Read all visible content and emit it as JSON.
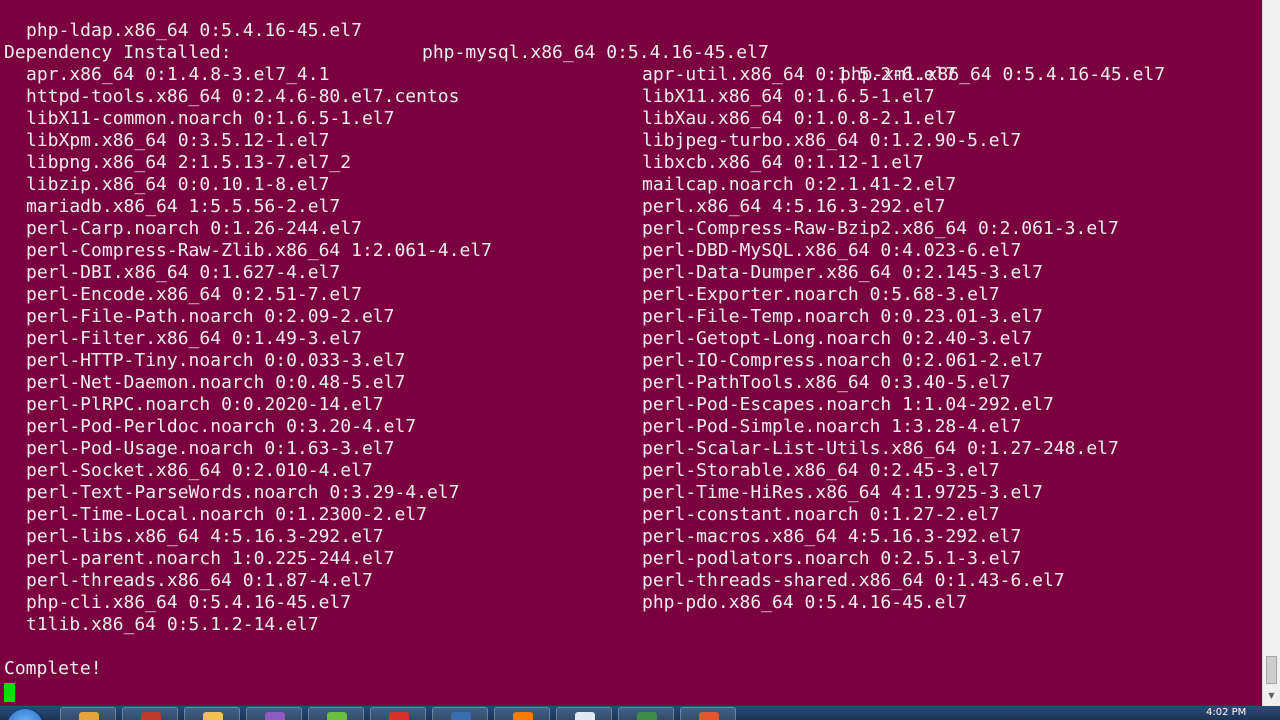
{
  "terminal": {
    "top_packages": [
      "php-ldap.x86_64 0:5.4.16-45.el7",
      "php-mysql.x86_64 0:5.4.16-45.el7",
      "php-xml.x86_64 0:5.4.16-45.el7"
    ],
    "dependency_header": "Dependency Installed:",
    "dependencies": [
      [
        "apr.x86_64 0:1.4.8-3.el7_4.1",
        "apr-util.x86_64 0:1.5.2-6.el7"
      ],
      [
        "httpd-tools.x86_64 0:2.4.6-80.el7.centos",
        "libX11.x86_64 0:1.6.5-1.el7"
      ],
      [
        "libX11-common.noarch 0:1.6.5-1.el7",
        "libXau.x86_64 0:1.0.8-2.1.el7"
      ],
      [
        "libXpm.x86_64 0:3.5.12-1.el7",
        "libjpeg-turbo.x86_64 0:1.2.90-5.el7"
      ],
      [
        "libpng.x86_64 2:1.5.13-7.el7_2",
        "libxcb.x86_64 0:1.12-1.el7"
      ],
      [
        "libzip.x86_64 0:0.10.1-8.el7",
        "mailcap.noarch 0:2.1.41-2.el7"
      ],
      [
        "mariadb.x86_64 1:5.5.56-2.el7",
        "perl.x86_64 4:5.16.3-292.el7"
      ],
      [
        "perl-Carp.noarch 0:1.26-244.el7",
        "perl-Compress-Raw-Bzip2.x86_64 0:2.061-3.el7"
      ],
      [
        "perl-Compress-Raw-Zlib.x86_64 1:2.061-4.el7",
        "perl-DBD-MySQL.x86_64 0:4.023-6.el7"
      ],
      [
        "perl-DBI.x86_64 0:1.627-4.el7",
        "perl-Data-Dumper.x86_64 0:2.145-3.el7"
      ],
      [
        "perl-Encode.x86_64 0:2.51-7.el7",
        "perl-Exporter.noarch 0:5.68-3.el7"
      ],
      [
        "perl-File-Path.noarch 0:2.09-2.el7",
        "perl-File-Temp.noarch 0:0.23.01-3.el7"
      ],
      [
        "perl-Filter.x86_64 0:1.49-3.el7",
        "perl-Getopt-Long.noarch 0:2.40-3.el7"
      ],
      [
        "perl-HTTP-Tiny.noarch 0:0.033-3.el7",
        "perl-IO-Compress.noarch 0:2.061-2.el7"
      ],
      [
        "perl-Net-Daemon.noarch 0:0.48-5.el7",
        "perl-PathTools.x86_64 0:3.40-5.el7"
      ],
      [
        "perl-PlRPC.noarch 0:0.2020-14.el7",
        "perl-Pod-Escapes.noarch 1:1.04-292.el7"
      ],
      [
        "perl-Pod-Perldoc.noarch 0:3.20-4.el7",
        "perl-Pod-Simple.noarch 1:3.28-4.el7"
      ],
      [
        "perl-Pod-Usage.noarch 0:1.63-3.el7",
        "perl-Scalar-List-Utils.x86_64 0:1.27-248.el7"
      ],
      [
        "perl-Socket.x86_64 0:2.010-4.el7",
        "perl-Storable.x86_64 0:2.45-3.el7"
      ],
      [
        "perl-Text-ParseWords.noarch 0:3.29-4.el7",
        "perl-Time-HiRes.x86_64 4:1.9725-3.el7"
      ],
      [
        "perl-Time-Local.noarch 0:1.2300-2.el7",
        "perl-constant.noarch 0:1.27-2.el7"
      ],
      [
        "perl-libs.x86_64 4:5.16.3-292.el7",
        "perl-macros.x86_64 4:5.16.3-292.el7"
      ],
      [
        "perl-parent.noarch 1:0.225-244.el7",
        "perl-podlators.noarch 0:2.5.1-3.el7"
      ],
      [
        "perl-threads.x86_64 0:1.87-4.el7",
        "perl-threads-shared.x86_64 0:1.43-6.el7"
      ],
      [
        "php-cli.x86_64 0:5.4.16-45.el7",
        "php-pdo.x86_64 0:5.4.16-45.el7"
      ],
      [
        "t1lib.x86_64 0:5.1.2-14.el7",
        ""
      ]
    ],
    "complete_text": "Complete!"
  },
  "taskbar": {
    "clock": "4:02 PM",
    "tray_text": "",
    "icons": [
      "chrome-icon",
      "paint-icon",
      "folder-icon",
      "visual-studio-icon",
      "notepad-plus-icon",
      "filezilla-icon",
      "app-window-icon",
      "firefox-icon",
      "notepad-icon",
      "terminal-icon",
      "sublime-icon"
    ],
    "icon_colors": [
      "#e8a43c",
      "#c0392b",
      "#f0c050",
      "#8e5bc5",
      "#6bbf3c",
      "#d9302b",
      "#3a6db0",
      "#f57c00",
      "#dfe8f2",
      "#3d8c4a",
      "#e4572e"
    ]
  }
}
